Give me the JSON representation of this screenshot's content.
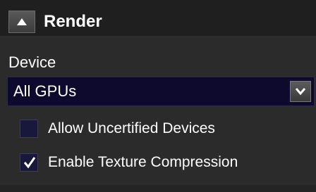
{
  "section": {
    "title": "Render",
    "collapse_icon": "triangle-up-icon"
  },
  "device": {
    "label": "Device",
    "selected": "All GPUs",
    "arrow_icon": "chevron-down-icon"
  },
  "options": [
    {
      "label": "Allow Uncertified Devices",
      "checked": false
    },
    {
      "label": "Enable Texture Compression",
      "checked": true
    }
  ]
}
